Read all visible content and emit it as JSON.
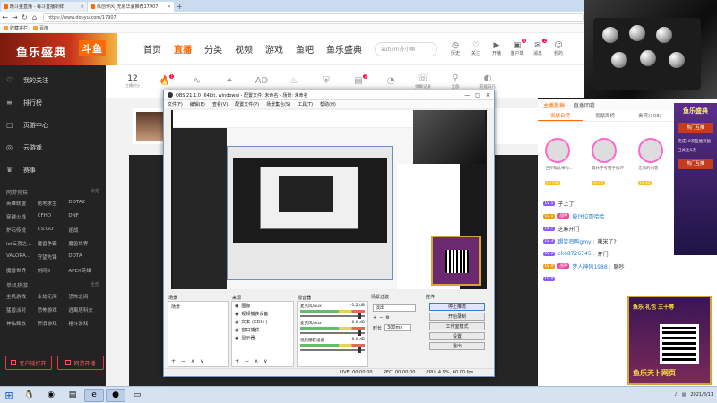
{
  "browser": {
    "tabs": [
      {
        "label": "晚斗鱼直播 - 每斗直播新鲜",
        "active": false
      },
      {
        "label": "陈创作风_无限华夏推荐17907",
        "active": true
      }
    ],
    "new_tab_glyph": "+",
    "url": "https://www.douyu.com/17907",
    "nav": {
      "back": "←",
      "forward": "→",
      "reload": "↻",
      "home": "⌂"
    },
    "bookmarks": [
      "收藏夹栏",
      "百度"
    ]
  },
  "douyu": {
    "logo_text": "鱼乐盛典",
    "logo_badge": "斗鱼",
    "nav": [
      "首页",
      "直播",
      "分类",
      "视频",
      "游戏",
      "鱼吧",
      "鱼乐盛典"
    ],
    "nav_active": "直播",
    "search_placeholder": "autism芥小鱼",
    "header_icons": [
      {
        "name": "history-icon",
        "glyph": "◷",
        "label": "历史"
      },
      {
        "name": "follow-icon",
        "glyph": "♡",
        "label": "关注"
      },
      {
        "name": "broadcast-icon",
        "glyph": "▶",
        "label": "开播"
      },
      {
        "name": "client-icon",
        "glyph": "▣",
        "label": "客户端",
        "badge": "4"
      },
      {
        "name": "message-icon",
        "glyph": "✉",
        "label": "消息",
        "badge": "2"
      },
      {
        "name": "user-icon",
        "glyph": "☺",
        "label": "我的"
      }
    ]
  },
  "sidebar": {
    "main": [
      {
        "icon": "♡",
        "name": "heart-icon",
        "label": "我的关注"
      },
      {
        "icon": "≡",
        "name": "list-icon",
        "label": "排行榜"
      },
      {
        "icon": "▢",
        "name": "page-icon",
        "label": "页游中心"
      },
      {
        "icon": "◎",
        "name": "cloud-icon",
        "label": "云游戏"
      },
      {
        "icon": "♛",
        "name": "trophy-icon",
        "label": "赛事"
      }
    ],
    "sections": [
      {
        "title": "网游竞技",
        "more": "全部",
        "items": [
          "英雄联盟",
          "绝地求生",
          "DOTA2",
          "穿越火线",
          "CFHD",
          "DNF",
          "炉石传说",
          "CS:GO",
          "逆战",
          "lol云顶之...",
          "魔兽争霸",
          "魔兽世界",
          "VALORA...",
          "守望先锋",
          "DOTA",
          "魔兽世界",
          "剑网3",
          "APEX英雄"
        ]
      },
      {
        "title": "单机热游",
        "more": "全部",
        "items": [
          "主机游戏",
          "永劫无间",
          "恐怖之间",
          "猛兽派对",
          "恐怖游戏",
          "逃离塔科夫",
          "神佑释放",
          "怀旧游戏",
          "格斗游戏"
        ]
      }
    ],
    "buttons": [
      "客户端打开",
      "网游开播"
    ]
  },
  "catbar": {
    "count": "12",
    "count_label": "主播积分",
    "items": [
      {
        "name": "fire-icon",
        "glyph": "🔥",
        "label": "",
        "badge": "1",
        "orange": true
      },
      {
        "name": "wave-icon",
        "glyph": "∿",
        "label": ""
      },
      {
        "name": "gift-icon",
        "glyph": "✦",
        "label": ""
      },
      {
        "name": "ad-icon",
        "glyph": "AD",
        "label": ""
      },
      {
        "name": "flame-icon",
        "glyph": "♨",
        "label": ""
      },
      {
        "name": "shield-icon",
        "glyph": "⛨",
        "label": ""
      },
      {
        "name": "box-icon",
        "glyph": "▤",
        "label": "",
        "badge": "2"
      },
      {
        "name": "clock-icon",
        "glyph": "◔",
        "label": ""
      },
      {
        "name": "chat-icon",
        "glyph": "☏",
        "label": "弹幕记录"
      },
      {
        "name": "user-icon",
        "glyph": "⚲",
        "label": "全部"
      },
      {
        "name": "more-icon",
        "glyph": "◐",
        "label": "充能日礼"
      }
    ]
  },
  "obs": {
    "title": "OBS 21.1.0 (64bit, windows) - 配置文件: 未命名 - 场景: 未命名",
    "window_buttons": [
      "—",
      "□",
      "✕"
    ],
    "menu": [
      "文件(F)",
      "编辑(E)",
      "查看(V)",
      "配置文件(P)",
      "场景集合(S)",
      "工具(T)",
      "帮助(H)"
    ],
    "panels": {
      "scenes": {
        "title": "场景",
        "items": [
          "场景"
        ]
      },
      "sources": {
        "title": "来源",
        "items": [
          "图像",
          "视频捕获设备",
          "文本 (GDI+)",
          "窗口捕获",
          "显示器"
        ]
      },
      "mixer": {
        "title": "混音器",
        "tracks": [
          {
            "name": "麦克风/Aux",
            "db": "-1.2 dB"
          },
          {
            "name": "麦克风/Aux",
            "db": "0.0 dB"
          },
          {
            "name": "视频捕获设备",
            "db": "0.0 dB"
          }
        ]
      },
      "transitions": {
        "title": "场景过渡",
        "mode": "淡出",
        "duration_label": "时长",
        "duration": "300ms"
      },
      "controls": {
        "title": "控件",
        "buttons": [
          "停止推流",
          "开始录制",
          "工作室模式",
          "设置",
          "退出"
        ]
      }
    },
    "panel_footer": "+ − ∧ ∨",
    "status": {
      "live": "LIVE: 00:00:00",
      "rec": "REC: 00:00:00",
      "cpu": "CPU: 4.9%, 60.00 fps"
    }
  },
  "right": {
    "tabs": [
      "主播投稿",
      "直播回看"
    ],
    "tab_active": "主播投稿",
    "subtabs": [
      "贡献日榜",
      "贡献周榜",
      "贵宾(108)",
      "粉丝"
    ],
    "subtab_active": "贡献日榜",
    "rank": [
      {
        "name": "世界和此事你...",
        "level": "LV 109"
      },
      {
        "name": "森林子考钳手搞坏",
        "level": "LV 42"
      },
      {
        "name": "无情的剑客",
        "level": "LV 48"
      }
    ],
    "chat": [
      {
        "level": "LV 5",
        "user": "",
        "text": "子上了",
        "badge": ""
      },
      {
        "level": "LV 1",
        "user": "战神",
        "text": "按住拉哥哈哈",
        "badge": "战神"
      },
      {
        "level": "LV 7",
        "user": "",
        "text": "芝麻开门",
        "badge": ""
      },
      {
        "level": "LV 3",
        "user": "踢笑鸡鸭gmy :",
        "text": "辣宋了?",
        "badge": ""
      },
      {
        "level": "LV 2",
        "user": "ck68726745 :",
        "text": "开门",
        "badge": ""
      },
      {
        "level": "LV 9",
        "user": "梦人神码1988 :",
        "text": "聊吵",
        "badge": "战神"
      },
      {
        "level": "LV 8",
        "user": "",
        "text": "",
        "badge": ""
      }
    ],
    "ad_banner": {
      "title": "鱼乐盛典",
      "button": "热门互推",
      "text": "完成10次互推奖励",
      "link": "已关注1次",
      "button2": "热门互推"
    },
    "qr_ad": {
      "top": "鱼乐 礼包 三十等",
      "bottom": "鱼乐天卜网页"
    }
  },
  "taskbar": {
    "start_glyph": "⊞",
    "apps": [
      {
        "name": "qq-icon",
        "glyph": "🐧",
        "active": false
      },
      {
        "name": "chrome-icon",
        "glyph": "◉",
        "active": false
      },
      {
        "name": "folder-icon",
        "glyph": "▤",
        "active": false
      },
      {
        "name": "browser-icon",
        "glyph": "e",
        "active": true
      },
      {
        "name": "obs-icon",
        "glyph": "●",
        "active": true
      },
      {
        "name": "window-icon",
        "glyph": "▭",
        "active": false
      }
    ],
    "clock_time": "",
    "clock_date": "2021/8/11"
  },
  "colors": {
    "brand": "#ff6a00",
    "sidebar": "#232323",
    "obs_bg": "#f0f0f0"
  }
}
